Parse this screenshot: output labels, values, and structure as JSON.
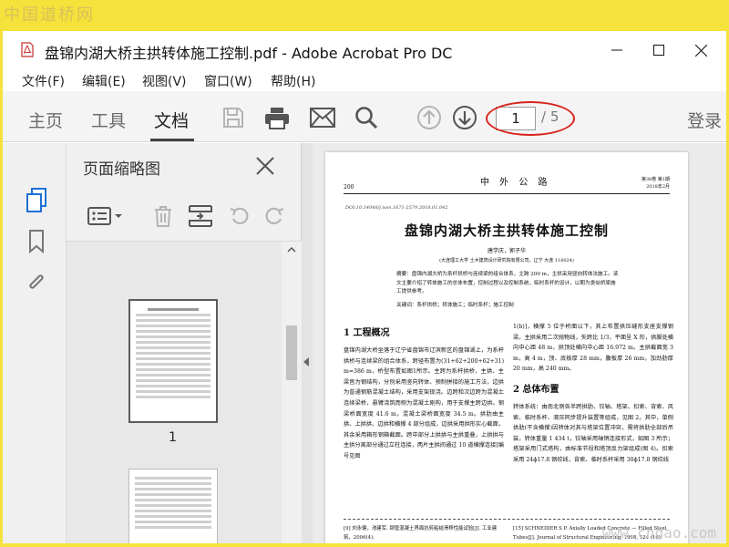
{
  "watermarks": {
    "top": "中国道桥网",
    "bottom": "www.cndao.com"
  },
  "window": {
    "title": "盘锦内湖大桥主拱转体施工控制.pdf - Adobe Acrobat Pro DC",
    "controls": {
      "minimize": "—",
      "maximize": "☐",
      "close": "✕"
    }
  },
  "menu": [
    "文件(F)",
    "编辑(E)",
    "视图(V)",
    "窗口(W)",
    "帮助(H)"
  ],
  "toolbar": {
    "tabs": [
      "主页",
      "工具",
      "文档"
    ],
    "active_tab": "文档",
    "page_current": "1",
    "page_total": "/ 5",
    "login": "登录",
    "highlight_color": "#d8251c"
  },
  "left_panel": {
    "title": "页面缩略图",
    "thumbnails": [
      {
        "number": "1"
      }
    ]
  },
  "document": {
    "header_page": "200",
    "journal": "中 外 公 路",
    "volume_line1": "第38卷  第1期",
    "volume_line2": "2018年2月",
    "doi": "DOI:10.14048/j.issn.1671-2579.2018.01.042",
    "title": "盘锦内湖大桥主拱转体施工控制",
    "authors": "唐学庆，郭子华",
    "affiliation": "(大连理工大学  土木建筑设计研究院有限公司，辽宁 大连  116024)",
    "abstract": "摘要：盘锦内湖大桥为系杆拱桥与连续梁的组合体系，主跨 200 m，主拱采用竖向转体法施工。该文主要介绍了转体施工的总体布置，控制过程以及控制系统，临时系杆的设计，以期为类似桥梁施工提供参考。",
    "keywords": "关键词：系杆拱桥；转体施工；临时系杆；施工控制",
    "section1_title": "1  工程概况",
    "section1_text": "盘锦内湖大桥坐落于辽宁省盘锦市辽滨新区的盘锦湖上，为系杆拱桥与连续梁的组合体系，跨径布置为(31+62+200+62+31) m=386 m，桥型布置如图1所示。主跨为系杆拱桥，主拱、主梁皆为钢结构，分别采用竖向转体、预制拼接的施工方法，边拱为普通钢筋混凝土结构，采用支架现浇。边跨和次边跨为混凝土连续梁桥，悬臂浇筑而侧为混凝土刚构，用于支撑主跨边拱。钢梁桥面宽度 41.6 m，混凝土梁桥面宽度 34.5 m。拱肋由主拱、上拱拱、边拱和横撑 4 部分组成，边拱采用拱形实心截面，其余采用箱形钢箱截面。跨中部分上拱拱与主拱重叠，上拱拱与主拱分离部分通过立柱连接，两片主拱间通过 10 道横撑连接[编号见图",
    "section1_cont": "1(b)]，横撑 5 位于桥面以下，其上布置拱压缝形支座支撑钢梁。主拱采用二次抛物线，矢跨比 1/3，平面呈 X 形，拱脚处横向中心距 48 m，拱顶处横向中心距 16.972 m。主拱截面宽 3 m，高 4 m，顶、底板厚 28 mm，腹板厚 26 mm，加劲肋厚 20 mm，高 240 mm。",
    "section2_title": "2  总体布置",
    "section2_text": "转体系统：由南北侧各半跨拱肋、铰轴、塔架、扣索、背索、风索、临时系杆、液压同步提升装置等组成，见图 2。其中，单侧拱肋(不含横撑)因转体对其与塔架位置冲突，需将拱肋全部后吊装，转体重量 1 434 t，铰轴采用轴销连接形式，如图 3 所示；塔架采用门式塔构，由标准节段和塔顶反力架组成(图 4)。扣索采用 24ϕ17.8 钢绞线，背索、临时系杆采用 30ϕ17.8 钢绞线",
    "ref_left": "[9]  刘永健，池建军. 钢管混凝土界面抗剪粘结滑移性能试验[J]. 工业建筑，2006(4).\n[10]  刘永健，刘君平，池建军. 钢管混凝土界面抗剪粘结滑移",
    "ref_right": "[15]  SCHNEIDER S P. Axially Loaded Concrete — Filled Steel Tubes[J]. Journal of Structural Engineering, 1998, 124 (10): 1125—1138."
  }
}
